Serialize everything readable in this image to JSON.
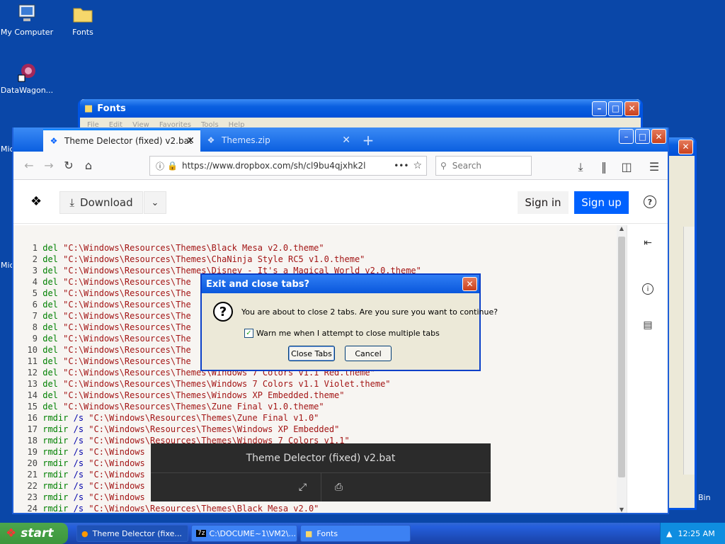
{
  "desktop": {
    "icons": [
      {
        "label": "My Computer"
      },
      {
        "label": "Fonts"
      },
      {
        "label": "DataWagon..."
      },
      {
        "label": "Mic"
      },
      {
        "label": "Mic"
      },
      {
        "label": "Bin"
      }
    ]
  },
  "fonts_window": {
    "title": "Fonts",
    "menu": [
      "File",
      "Edit",
      "View",
      "Favorites",
      "Tools",
      "Help"
    ]
  },
  "browser": {
    "tabs": [
      {
        "label": "Theme Delector (fixed) v2.bat"
      },
      {
        "label": "Themes.zip"
      }
    ],
    "url": "https://www.dropbox.com/sh/cl9bu4qjxhk2l",
    "search_placeholder": "Search"
  },
  "dropbox": {
    "download_label": "Download",
    "signin_label": "Sign in",
    "signup_label": "Sign up"
  },
  "code_lines": [
    {
      "n": "1",
      "cmd": "del",
      "arg": "",
      "str": "\"C:\\Windows\\Resources\\Themes\\Black Mesa v2.0.theme\""
    },
    {
      "n": "2",
      "cmd": "del",
      "arg": "",
      "str": "\"C:\\Windows\\Resources\\Themes\\ChaNinja Style RC5 v1.0.theme\""
    },
    {
      "n": "3",
      "cmd": "del",
      "arg": "",
      "str": "\"C:\\Windows\\Resources\\Themes\\Disney - It's a Magical World v2.0.theme\""
    },
    {
      "n": "4",
      "cmd": "del",
      "arg": "",
      "str": "\"C:\\Windows\\Resources\\The"
    },
    {
      "n": "5",
      "cmd": "del",
      "arg": "",
      "str": "\"C:\\Windows\\Resources\\The"
    },
    {
      "n": "6",
      "cmd": "del",
      "arg": "",
      "str": "\"C:\\Windows\\Resources\\The"
    },
    {
      "n": "7",
      "cmd": "del",
      "arg": "",
      "str": "\"C:\\Windows\\Resources\\The"
    },
    {
      "n": "8",
      "cmd": "del",
      "arg": "",
      "str": "\"C:\\Windows\\Resources\\The"
    },
    {
      "n": "9",
      "cmd": "del",
      "arg": "",
      "str": "\"C:\\Windows\\Resources\\The"
    },
    {
      "n": "10",
      "cmd": "del",
      "arg": "",
      "str": "\"C:\\Windows\\Resources\\The"
    },
    {
      "n": "11",
      "cmd": "del",
      "arg": "",
      "str": "\"C:\\Windows\\Resources\\The"
    },
    {
      "n": "12",
      "cmd": "del",
      "arg": "",
      "str": "\"C:\\Windows\\Resources\\Themes\\Windows 7 Colors v1.1 Red.theme\""
    },
    {
      "n": "13",
      "cmd": "del",
      "arg": "",
      "str": "\"C:\\Windows\\Resources\\Themes\\Windows 7 Colors v1.1 Violet.theme\""
    },
    {
      "n": "14",
      "cmd": "del",
      "arg": "",
      "str": "\"C:\\Windows\\Resources\\Themes\\Windows XP Embedded.theme\""
    },
    {
      "n": "15",
      "cmd": "del",
      "arg": "",
      "str": "\"C:\\Windows\\Resources\\Themes\\Zune Final v1.0.theme\""
    },
    {
      "n": "16",
      "cmd": "rmdir",
      "arg": "/s",
      "str": "\"C:\\Windows\\Resources\\Themes\\Zune Final v1.0\""
    },
    {
      "n": "17",
      "cmd": "rmdir",
      "arg": "/s",
      "str": "\"C:\\Windows\\Resources\\Themes\\Windows XP Embedded\""
    },
    {
      "n": "18",
      "cmd": "rmdir",
      "arg": "/s",
      "str": "\"C:\\Windows\\Resources\\Themes\\Windows 7 Colors v1.1\""
    },
    {
      "n": "19",
      "cmd": "rmdir",
      "arg": "/s",
      "str": "\"C:\\Windows"
    },
    {
      "n": "20",
      "cmd": "rmdir",
      "arg": "/s",
      "str": "\"C:\\Windows"
    },
    {
      "n": "21",
      "cmd": "rmdir",
      "arg": "/s",
      "str": "\"C:\\Windows"
    },
    {
      "n": "22",
      "cmd": "rmdir",
      "arg": "/s",
      "str": "\"C:\\Windows"
    },
    {
      "n": "23",
      "cmd": "rmdir",
      "arg": "/s",
      "str": "\"C:\\Windows"
    },
    {
      "n": "24",
      "cmd": "rmdir",
      "arg": "/s",
      "str": "\"C:\\Windows\\Resources\\Themes\\Black Mesa v2.0\""
    }
  ],
  "overlay": {
    "title": "Theme Delector (fixed) v2.bat"
  },
  "dialog": {
    "title": "Exit and close tabs?",
    "message": "You are about to close 2 tabs. Are you sure you want to continue?",
    "checkbox_label": "Warn me when I attempt to close multiple tabs",
    "checkbox_checked": true,
    "close_tabs_label": "Close Tabs",
    "cancel_label": "Cancel"
  },
  "taskbar": {
    "start_label": "start",
    "buttons": [
      {
        "label": "Theme Delector (fixe..."
      },
      {
        "label": "C:\\DOCUME~1\\VM2\\..."
      },
      {
        "label": "Fonts"
      }
    ],
    "clock": "12:25 AM"
  },
  "colors": {
    "desktop": "#0a47a8",
    "xp_blue": "#0054e3",
    "dropbox_blue": "#0061fe"
  }
}
